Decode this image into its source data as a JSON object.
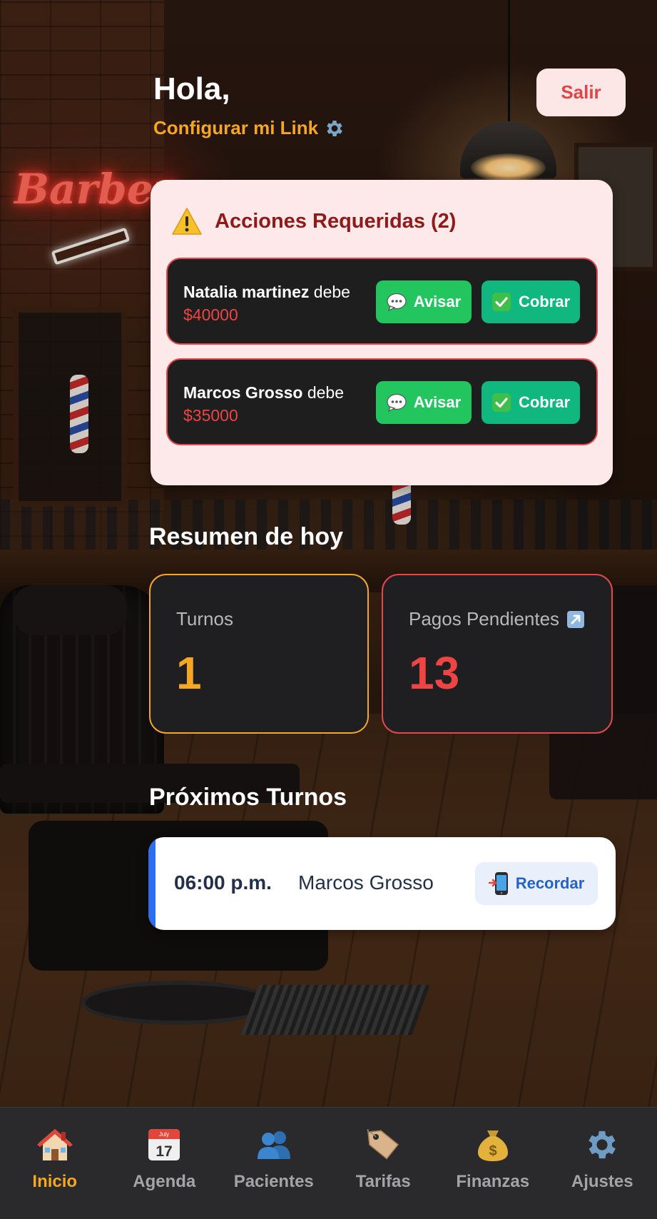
{
  "header": {
    "greeting": "Hola,",
    "config_link": "Configurar mi Link",
    "config_icon": "gear-icon",
    "logout_label": "Salir"
  },
  "actions": {
    "icon": "warning-icon",
    "title": "Acciones Requeridas (2)",
    "items": [
      {
        "name": "Natalia martinez",
        "verb": "debe",
        "amount": "$40000",
        "notify_label": "Avisar",
        "charge_label": "Cobrar"
      },
      {
        "name": "Marcos Grosso",
        "verb": "debe",
        "amount": "$35000",
        "notify_label": "Avisar",
        "charge_label": "Cobrar"
      }
    ]
  },
  "summary": {
    "title": "Resumen de hoy",
    "turnos": {
      "label": "Turnos",
      "value": "1"
    },
    "pagos": {
      "label": "Pagos Pendientes",
      "value": "13",
      "icon": "arrow-up-right-icon"
    }
  },
  "upcoming": {
    "title": "Próximos Turnos",
    "items": [
      {
        "time": "06:00 p.m.",
        "name": "Marcos Grosso",
        "remind_label": "Recordar",
        "remind_icon": "phone-icon"
      }
    ]
  },
  "nav": {
    "items": [
      {
        "label": "Inicio",
        "icon": "home-icon",
        "active": true
      },
      {
        "label": "Agenda",
        "icon": "calendar-icon",
        "calendar_month": "July",
        "calendar_day": "17"
      },
      {
        "label": "Pacientes",
        "icon": "users-icon"
      },
      {
        "label": "Tarifas",
        "icon": "tag-icon"
      },
      {
        "label": "Finanzas",
        "icon": "money-bag-icon"
      },
      {
        "label": "Ajustes",
        "icon": "gear-icon"
      }
    ]
  },
  "background": {
    "neon_sign": "Barber"
  },
  "colors": {
    "accent_orange": "#f5a623",
    "danger_red": "#ef4444",
    "whatsapp_green": "#22c55e",
    "charge_green": "#10b77f",
    "primary_blue": "#2f6df0"
  }
}
